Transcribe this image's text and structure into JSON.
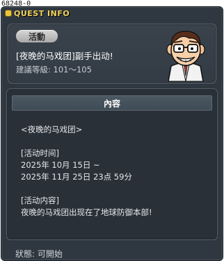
{
  "quest_id": "68248-0",
  "window": {
    "title": "QUEST INFO"
  },
  "header": {
    "badge": "活動",
    "quest_name": "[夜晚的马戏团]副手出动!",
    "level_requirement": "建議等級: 101～105",
    "npc_icon": "npc-doctor-portrait"
  },
  "content": {
    "header_label": "內容",
    "lines": [
      "<夜晚的马戏团>",
      "",
      "[活动时间]",
      "2025年 10月 15日 ~",
      "2025年 11月 25日 23点 59分",
      "",
      "[活动内容]",
      "夜晚的马戏团出现在了地球防御本部!"
    ]
  },
  "status": {
    "label": "狀態: 可開始"
  },
  "colors": {
    "title_accent": "#f3d35b",
    "window_bg": "#2f3740",
    "panel_bg": "#2a3038"
  }
}
